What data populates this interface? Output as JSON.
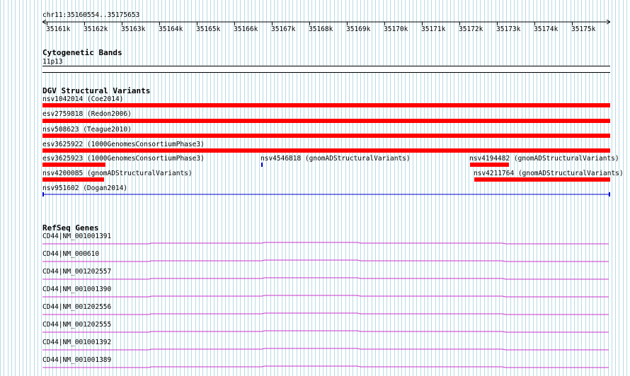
{
  "ruler": {
    "position": "chr11:35160554..35175653",
    "ticks": [
      "35161k",
      "35162k",
      "35163k",
      "35164k",
      "35165k",
      "35166k",
      "35167k",
      "35168k",
      "35169k",
      "35170k",
      "35171k",
      "35172k",
      "35173k",
      "35174k",
      "35175k"
    ]
  },
  "cytobands": {
    "title": "Cytogenetic Bands",
    "band": "11p13"
  },
  "dgv": {
    "title": "DGV Structural Variants",
    "features": [
      {
        "label": "nsv1042014 (Coe2014)",
        "color": "#ff0000",
        "kind": "bar"
      },
      {
        "label": "esv2759818 (Redon2006)",
        "color": "#ff0000",
        "kind": "bar"
      },
      {
        "label": "nsv508623 (Teague2010)",
        "color": "#ff0000",
        "kind": "bar"
      },
      {
        "label": "esv3625922 (1000GenomesConsortiumPhase3)",
        "color": "#ff0000",
        "kind": "bar"
      },
      {
        "label": "esv3625923 (1000GenomesConsortiumPhase3)",
        "color": "#ff0000",
        "kind": "bar"
      },
      {
        "label": "nsv4546818 (gnomADStructuralVariants)",
        "color": "#0000cc",
        "kind": "tick"
      },
      {
        "label": "nsv4194482 (gnomADStructuralVariants)",
        "color": "#ff0000",
        "kind": "bar"
      },
      {
        "label": "nsv4200085 (gnomADStructuralVariants)",
        "color": "#ff0000",
        "kind": "bar"
      },
      {
        "label": "nsv4211764 (gnomADStructuralVariants)",
        "color": "#ff0000",
        "kind": "bar"
      },
      {
        "label": "nsv951602 (Dogan2014)",
        "color": "#0000cc",
        "kind": "line"
      }
    ]
  },
  "refseq": {
    "title": "RefSeq Genes",
    "color": "#cc33cc",
    "genes": [
      "CD44|NM_001001391",
      "CD44|NM_000610",
      "CD44|NM_001202557",
      "CD44|NM_001001390",
      "CD44|NM_001202556",
      "CD44|NM_001202555",
      "CD44|NM_001001392",
      "CD44|NM_001001389"
    ]
  },
  "colors": {
    "grid": "#b8dbe4",
    "variant": "#ff0000",
    "small_variant": "#0000cc",
    "gene": "#cc33cc"
  }
}
